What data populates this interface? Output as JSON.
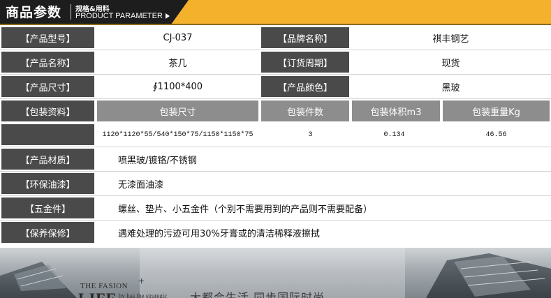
{
  "header": {
    "title": "商品参数",
    "subtitle_cn": "规格&用料",
    "subtitle_en": "PRODUCT PARAMETER"
  },
  "rows": {
    "model": {
      "label": "【产品型号】",
      "value": "CJ-037"
    },
    "brand": {
      "label": "【品牌名称】",
      "value": "祺丰钢艺"
    },
    "name": {
      "label": "【产品名称】",
      "value": "茶几"
    },
    "lead_time": {
      "label": "【订货周期】",
      "value": "现货"
    },
    "size": {
      "label": "【产品尺寸】",
      "value": "∮1100*400"
    },
    "color": {
      "label": "【产品颜色】",
      "value": "黑玻"
    },
    "packing": {
      "label": "【包装资料】",
      "headers": [
        "包装尺寸",
        "包装件数",
        "包装体积m3",
        "包装重量Kg"
      ],
      "values": [
        "1120*1120*55/540*150*75/1150*1150*75",
        "3",
        "0.134",
        "46.56"
      ]
    },
    "material": {
      "label": "【产品材质】",
      "value": "喷黑玻/镀铬/不锈钢"
    },
    "paint": {
      "label": "【环保油漆】",
      "value": "无漆面油漆"
    },
    "hardware": {
      "label": "【五金件】",
      "value": "螺丝、垫片、小五金件（个别不需要用到的产品则不需要配备）"
    },
    "maintenance": {
      "label": "【保养保修】",
      "value": "遇难处理的污迹可用30%牙膏或的清洁稀释液擦拭"
    }
  },
  "footer": {
    "fasion": "THE FASION",
    "plus": "+",
    "life": "LIFE",
    "small": "by has the strategic",
    "cn": "大都会生活  同步国际时尚"
  }
}
